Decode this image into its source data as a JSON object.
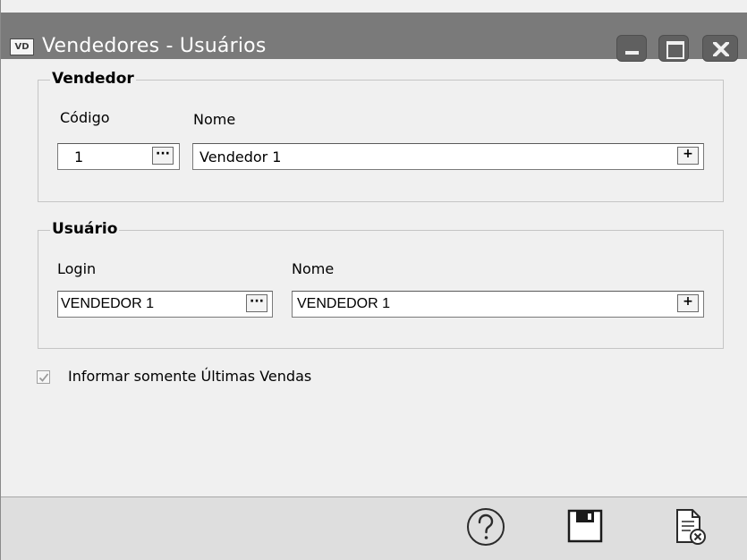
{
  "window": {
    "app_icon_text": "VD",
    "title": "Vendedores - Usuários"
  },
  "vendedor": {
    "legend": "Vendedor",
    "codigo_label": "Código",
    "nome_label": "Nome",
    "codigo_value": "1",
    "nome_value": "Vendedor 1",
    "lookup_label": "···",
    "add_label": "+"
  },
  "usuario": {
    "legend": "Usuário",
    "login_label": "Login",
    "nome_label": "Nome",
    "login_value": "VENDEDOR 1",
    "nome_value": "VENDEDOR 1",
    "lookup_label": "···",
    "add_label": "+"
  },
  "options": {
    "ultimas_vendas_label": "Informar somente Últimas Vendas",
    "ultimas_vendas_checked": true
  },
  "footer": {
    "icons": [
      "help-icon",
      "save-icon",
      "cancel-document-icon"
    ]
  }
}
